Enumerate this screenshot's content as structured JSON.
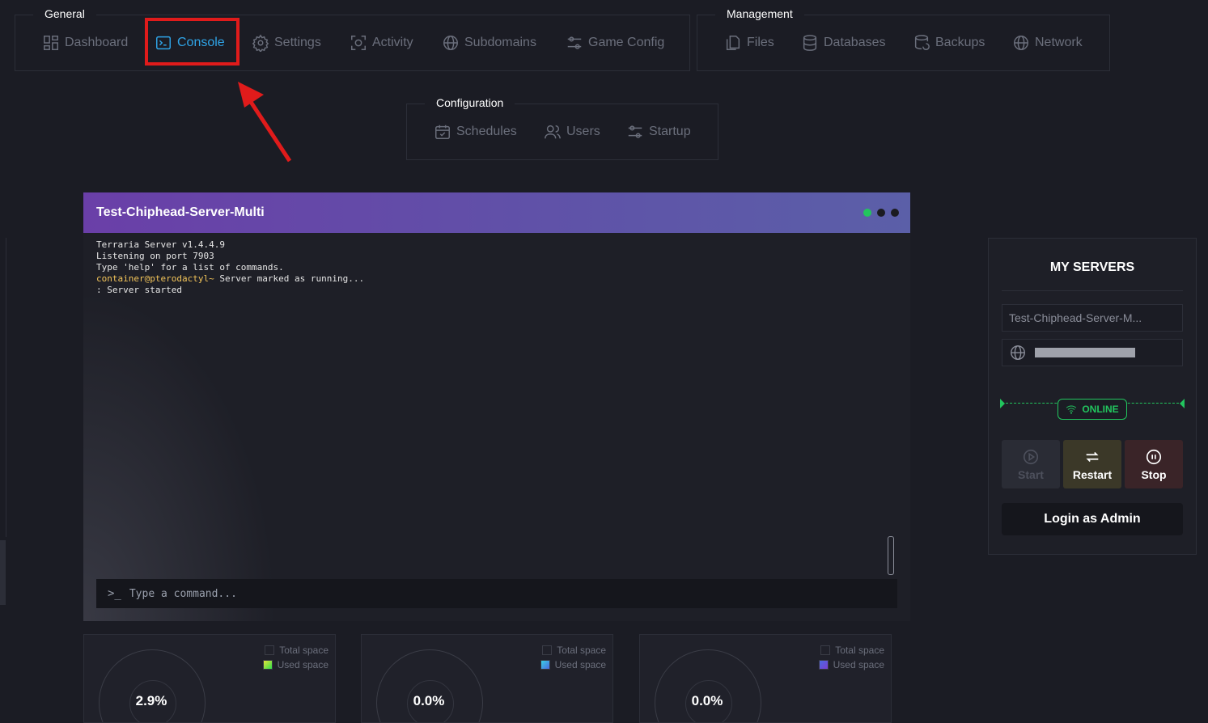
{
  "nav": {
    "general": {
      "title": "General",
      "items": [
        {
          "label": "Dashboard",
          "icon": "dashboard-icon"
        },
        {
          "label": "Console",
          "icon": "terminal-icon",
          "active": true
        },
        {
          "label": "Settings",
          "icon": "gear-icon"
        },
        {
          "label": "Activity",
          "icon": "activity-icon"
        },
        {
          "label": "Subdomains",
          "icon": "globe-icon"
        },
        {
          "label": "Game Config",
          "icon": "sliders-icon"
        }
      ]
    },
    "management": {
      "title": "Management",
      "items": [
        {
          "label": "Files",
          "icon": "files-icon"
        },
        {
          "label": "Databases",
          "icon": "database-icon"
        },
        {
          "label": "Backups",
          "icon": "backup-icon"
        },
        {
          "label": "Network",
          "icon": "globe-icon"
        }
      ]
    },
    "configuration": {
      "title": "Configuration",
      "items": [
        {
          "label": "Schedules",
          "icon": "calendar-icon"
        },
        {
          "label": "Users",
          "icon": "users-icon"
        },
        {
          "label": "Startup",
          "icon": "sliders-icon"
        }
      ]
    }
  },
  "console": {
    "title": "Test-Chiphead-Server-Multi",
    "lines": [
      "Terraria Server v1.4.4.9",
      "Listening on port 7903",
      "Type 'help' for a list of commands."
    ],
    "prompt_user": "container@pterodactyl~",
    "prompt_text": " Server marked as running...",
    "last_line": ": Server started",
    "command_prefix": ">_",
    "command_placeholder": "Type a command..."
  },
  "stats": [
    {
      "value": "2.9%",
      "legend_total": "Total space",
      "legend_used": "Used space",
      "used_color": "#8be04a"
    },
    {
      "value": "0.0%",
      "legend_total": "Total space",
      "legend_used": "Used space",
      "used_color": "#4a8be0"
    },
    {
      "value": "0.0%",
      "legend_total": "Total space",
      "legend_used": "Used space",
      "used_color": "#6a3fd0"
    }
  ],
  "servers": {
    "title": "MY SERVERS",
    "server_name": "Test-Chiphead-Server-M...",
    "status": "ONLINE",
    "buttons": {
      "start": "Start",
      "restart": "Restart",
      "stop": "Stop"
    },
    "admin_label": "Login as Admin"
  },
  "colors": {
    "accent": "#2fa4e7",
    "online": "#22c55e",
    "highlight": "#e01b1b"
  }
}
